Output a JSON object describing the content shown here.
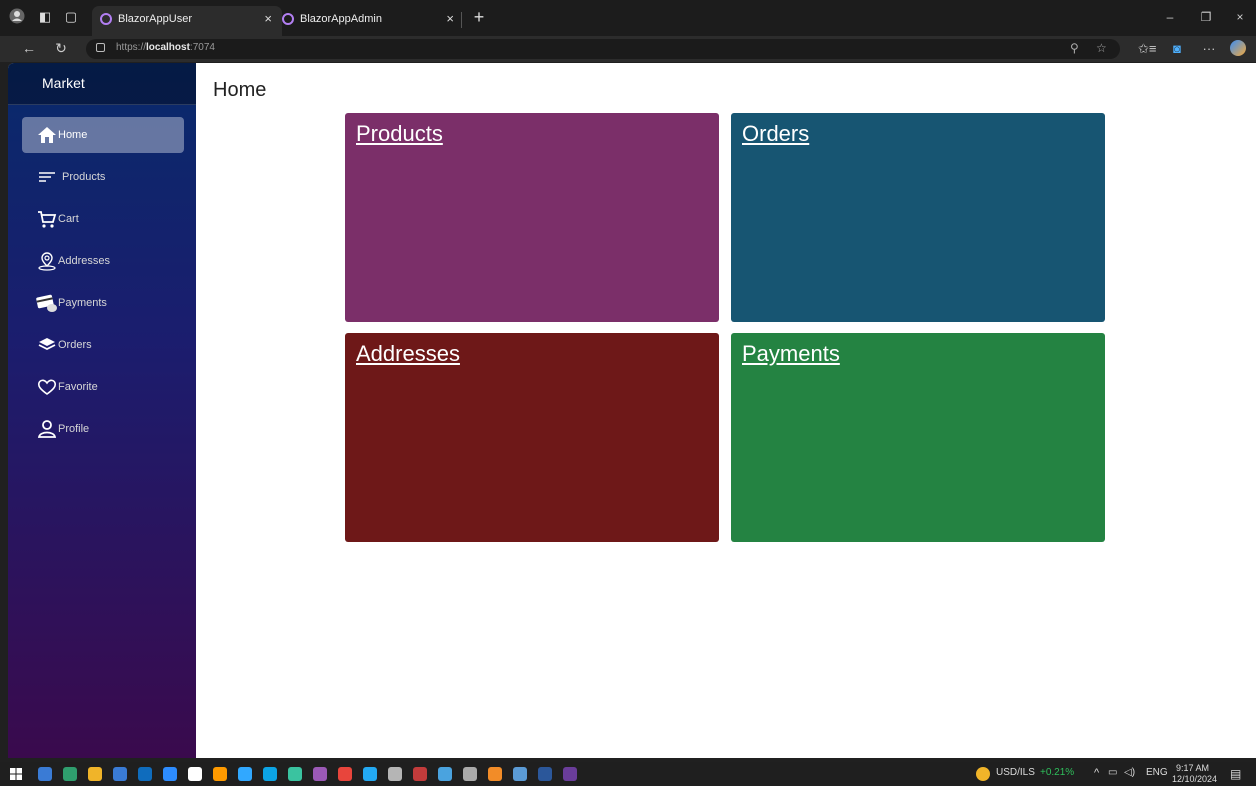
{
  "browser": {
    "tabs": [
      {
        "title": "BlazorAppUser",
        "active": true
      },
      {
        "title": "BlazorAppAdmin",
        "active": false
      }
    ],
    "url_prefix": "https://",
    "url_host": "localhost",
    "url_port": ":7074",
    "icons": {
      "back": "←",
      "refresh": "↻",
      "close": "×",
      "new_tab": "+",
      "minimize": "–",
      "restore": "❐",
      "star": "☆",
      "more": "···",
      "key": "⚲",
      "favorites": "✩≡",
      "tabs_icon": "▢"
    }
  },
  "sidebar": {
    "brand": "Market",
    "items": [
      {
        "label": "Home",
        "icon": "home-icon",
        "active": true
      },
      {
        "label": "Products",
        "icon": "list-icon",
        "active": false
      },
      {
        "label": "Cart",
        "icon": "cart-icon",
        "active": false
      },
      {
        "label": "Addresses",
        "icon": "map-pin-icon",
        "active": false
      },
      {
        "label": "Payments",
        "icon": "credit-card-icon",
        "active": false
      },
      {
        "label": "Orders",
        "icon": "layers-icon",
        "active": false
      },
      {
        "label": "Favorite",
        "icon": "heart-icon",
        "active": false
      },
      {
        "label": "Profile",
        "icon": "user-icon",
        "active": false
      }
    ]
  },
  "main": {
    "title": "Home",
    "cards": [
      {
        "label": "Products",
        "color": "#7b2f69"
      },
      {
        "label": "Orders",
        "color": "#175572"
      },
      {
        "label": "Addresses",
        "color": "#6e1818"
      },
      {
        "label": "Payments",
        "color": "#248342"
      }
    ]
  },
  "taskbar": {
    "ticker": "USD/ILS",
    "change": "+0.21%",
    "lang": "ENG",
    "time": "9:17 AM",
    "date": "12/10/2024",
    "app_colors": [
      "#3a7bd5",
      "#2f9e6e",
      "#f0b429",
      "#3a7bd5",
      "#0f6cbd",
      "#2d8cff",
      "#ffffff",
      "#ff9a00",
      "#31a8ff",
      "#0ca4e5",
      "#3ac3a0",
      "#9b59b6",
      "#e8453c",
      "#23a9f2",
      "#b5b5b5",
      "#c23b3b",
      "#4aa3df",
      "#aaaaaa",
      "#f28c28",
      "#5b9bd5",
      "#2b579a",
      "#6a3d9a"
    ]
  }
}
